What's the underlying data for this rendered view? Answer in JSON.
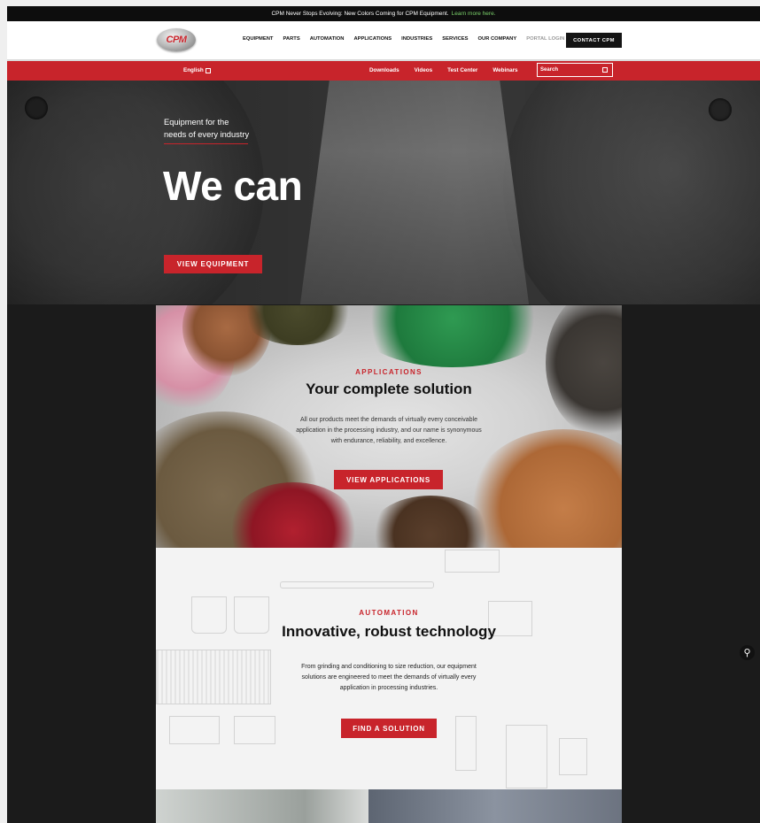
{
  "announcement": {
    "text": "CPM Never Stops Evolving: New Colors Coming for CPM Equipment.",
    "link": "Learn more here."
  },
  "logo": {
    "text": "CPM"
  },
  "nav": {
    "items": [
      "EQUIPMENT",
      "PARTS",
      "AUTOMATION",
      "APPLICATIONS",
      "INDUSTRIES",
      "SERVICES",
      "OUR COMPANY"
    ],
    "portal": "PORTAL LOGIN",
    "contact": "CONTACT CPM"
  },
  "utility": {
    "language": "English",
    "links": [
      "Downloads",
      "Videos",
      "Test Center",
      "Webinars"
    ],
    "search_placeholder": "Search"
  },
  "hero": {
    "subtitle_line1": "Equipment for the",
    "subtitle_line2": "needs of every industry",
    "title": "We can",
    "button": "VIEW EQUIPMENT"
  },
  "applications": {
    "kicker": "APPLICATIONS",
    "heading": "Your complete solution",
    "body_line1": "All our products meet the demands of virtually every conceivable",
    "body_line2": "application in the processing industry, and our name is synonymous",
    "body_line3": "with endurance, reliability, and excellence.",
    "button": "VIEW APPLICATIONS"
  },
  "automation": {
    "kicker": "AUTOMATION",
    "heading": "Innovative, robust technology",
    "body_line1": "From grinding and conditioning to size reduction, our equipment",
    "body_line2": "solutions are engineered to meet the demands of virtually every",
    "body_line3": "application in processing industries.",
    "button": "FIND A SOLUTION"
  },
  "colors": {
    "brand_red": "#c8242b",
    "dark": "#141414",
    "link_green": "#7bd16b"
  }
}
